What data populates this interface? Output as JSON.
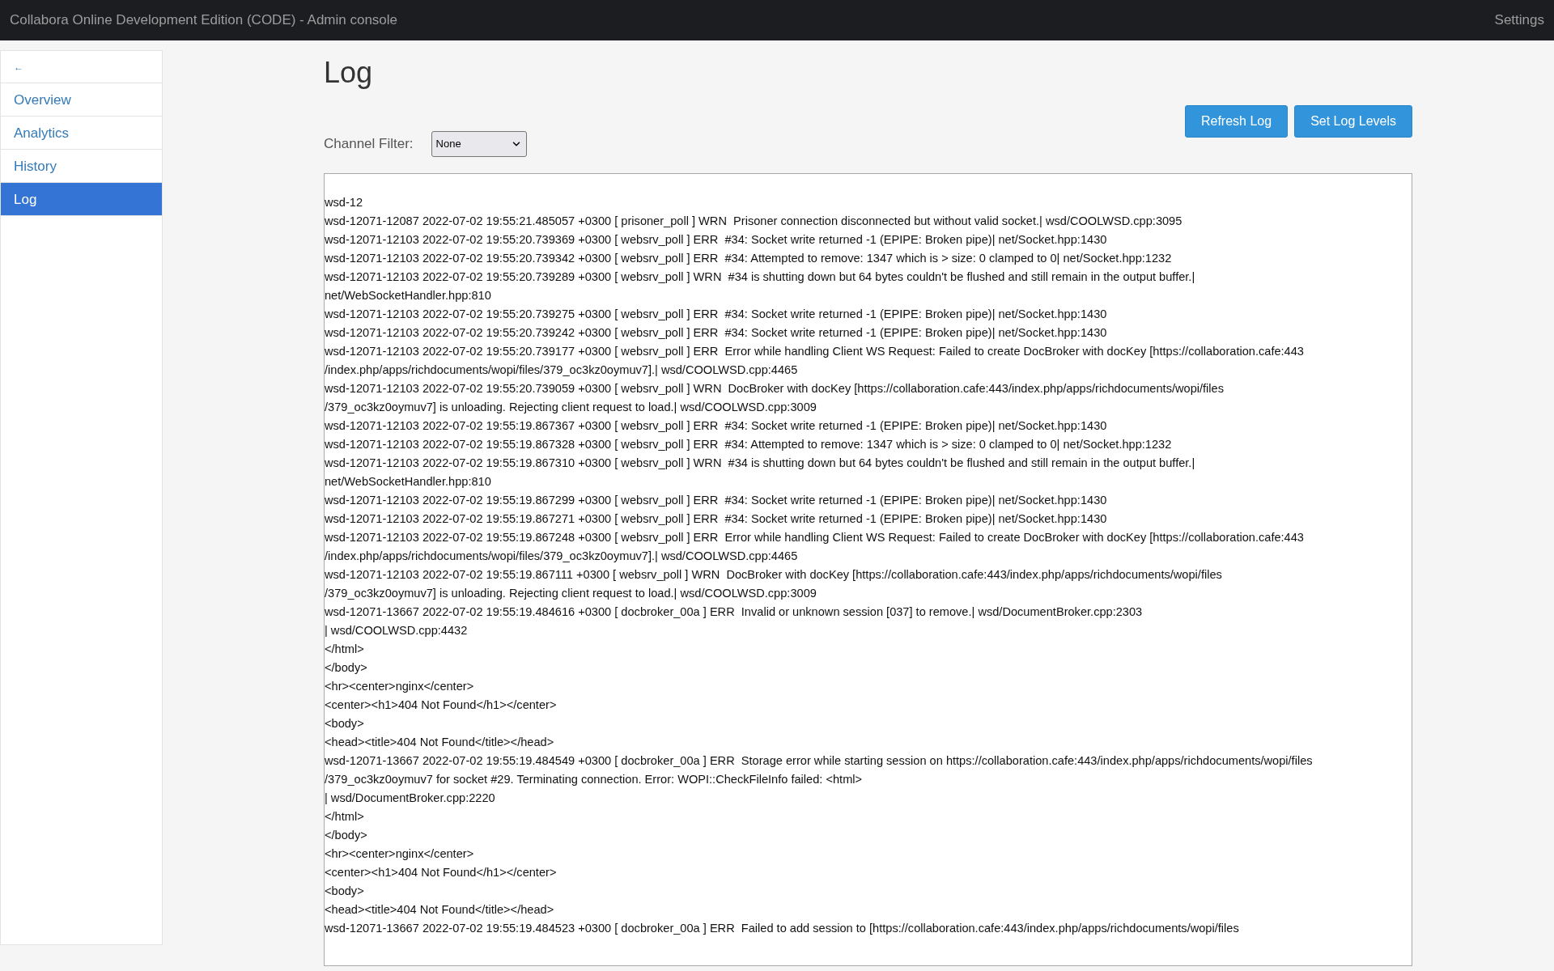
{
  "header": {
    "title": "Collabora Online Development Edition (CODE) - Admin console",
    "settings_link": "Settings"
  },
  "sidebar": {
    "back": "←",
    "items": [
      {
        "label": "Overview",
        "selected": false
      },
      {
        "label": "Analytics",
        "selected": false
      },
      {
        "label": "History",
        "selected": false
      },
      {
        "label": "Log",
        "selected": true
      }
    ]
  },
  "page": {
    "title": "Log",
    "buttons": [
      "Refresh Log",
      "Set Log Levels"
    ],
    "channel_filter": {
      "label": "Channel Filter:",
      "value": "None"
    }
  },
  "log_lines": [
    "wsd-12",
    "wsd-12071-12087 2022-07-02 19:55:21.485057 +0300 [ prisoner_poll ] WRN  Prisoner connection disconnected but without valid socket.| wsd/COOLWSD.cpp:3095",
    "wsd-12071-12103 2022-07-02 19:55:20.739369 +0300 [ websrv_poll ] ERR  #34: Socket write returned -1 (EPIPE: Broken pipe)| net/Socket.hpp:1430",
    "wsd-12071-12103 2022-07-02 19:55:20.739342 +0300 [ websrv_poll ] ERR  #34: Attempted to remove: 1347 which is > size: 0 clamped to 0| net/Socket.hpp:1232",
    "wsd-12071-12103 2022-07-02 19:55:20.739289 +0300 [ websrv_poll ] WRN  #34 is shutting down but 64 bytes couldn't be flushed and still remain in the output buffer.|",
    "net/WebSocketHandler.hpp:810",
    "wsd-12071-12103 2022-07-02 19:55:20.739275 +0300 [ websrv_poll ] ERR  #34: Socket write returned -1 (EPIPE: Broken pipe)| net/Socket.hpp:1430",
    "wsd-12071-12103 2022-07-02 19:55:20.739242 +0300 [ websrv_poll ] ERR  #34: Socket write returned -1 (EPIPE: Broken pipe)| net/Socket.hpp:1430",
    "wsd-12071-12103 2022-07-02 19:55:20.739177 +0300 [ websrv_poll ] ERR  Error while handling Client WS Request: Failed to create DocBroker with docKey [https://collaboration.cafe:443",
    "/index.php/apps/richdocuments/wopi/files/379_oc3kz0oymuv7].| wsd/COOLWSD.cpp:4465",
    "wsd-12071-12103 2022-07-02 19:55:20.739059 +0300 [ websrv_poll ] WRN  DocBroker with docKey [https://collaboration.cafe:443/index.php/apps/richdocuments/wopi/files",
    "/379_oc3kz0oymuv7] is unloading. Rejecting client request to load.| wsd/COOLWSD.cpp:3009",
    "wsd-12071-12103 2022-07-02 19:55:19.867367 +0300 [ websrv_poll ] ERR  #34: Socket write returned -1 (EPIPE: Broken pipe)| net/Socket.hpp:1430",
    "wsd-12071-12103 2022-07-02 19:55:19.867328 +0300 [ websrv_poll ] ERR  #34: Attempted to remove: 1347 which is > size: 0 clamped to 0| net/Socket.hpp:1232",
    "wsd-12071-12103 2022-07-02 19:55:19.867310 +0300 [ websrv_poll ] WRN  #34 is shutting down but 64 bytes couldn't be flushed and still remain in the output buffer.|",
    "net/WebSocketHandler.hpp:810",
    "wsd-12071-12103 2022-07-02 19:55:19.867299 +0300 [ websrv_poll ] ERR  #34: Socket write returned -1 (EPIPE: Broken pipe)| net/Socket.hpp:1430",
    "wsd-12071-12103 2022-07-02 19:55:19.867271 +0300 [ websrv_poll ] ERR  #34: Socket write returned -1 (EPIPE: Broken pipe)| net/Socket.hpp:1430",
    "wsd-12071-12103 2022-07-02 19:55:19.867248 +0300 [ websrv_poll ] ERR  Error while handling Client WS Request: Failed to create DocBroker with docKey [https://collaboration.cafe:443",
    "/index.php/apps/richdocuments/wopi/files/379_oc3kz0oymuv7].| wsd/COOLWSD.cpp:4465",
    "wsd-12071-12103 2022-07-02 19:55:19.867111 +0300 [ websrv_poll ] WRN  DocBroker with docKey [https://collaboration.cafe:443/index.php/apps/richdocuments/wopi/files",
    "/379_oc3kz0oymuv7] is unloading. Rejecting client request to load.| wsd/COOLWSD.cpp:3009",
    "wsd-12071-13667 2022-07-02 19:55:19.484616 +0300 [ docbroker_00a ] ERR  Invalid or unknown session [037] to remove.| wsd/DocumentBroker.cpp:2303",
    "| wsd/COOLWSD.cpp:4432",
    "</html>",
    "</body>",
    "<hr><center>nginx</center>",
    "<center><h1>404 Not Found</h1></center>",
    "<body>",
    "<head><title>404 Not Found</title></head>",
    "wsd-12071-13667 2022-07-02 19:55:19.484549 +0300 [ docbroker_00a ] ERR  Storage error while starting session on https://collaboration.cafe:443/index.php/apps/richdocuments/wopi/files",
    "/379_oc3kz0oymuv7 for socket #29. Terminating connection. Error: WOPI::CheckFileInfo failed: <html>",
    "| wsd/DocumentBroker.cpp:2220",
    "</html>",
    "</body>",
    "<hr><center>nginx</center>",
    "<center><h1>404 Not Found</h1></center>",
    "<body>",
    "<head><title>404 Not Found</title></head>",
    "wsd-12071-13667 2022-07-02 19:55:19.484523 +0300 [ docbroker_00a ] ERR  Failed to add session to [https://collaboration.cafe:443/index.php/apps/richdocuments/wopi/files"
  ]
}
